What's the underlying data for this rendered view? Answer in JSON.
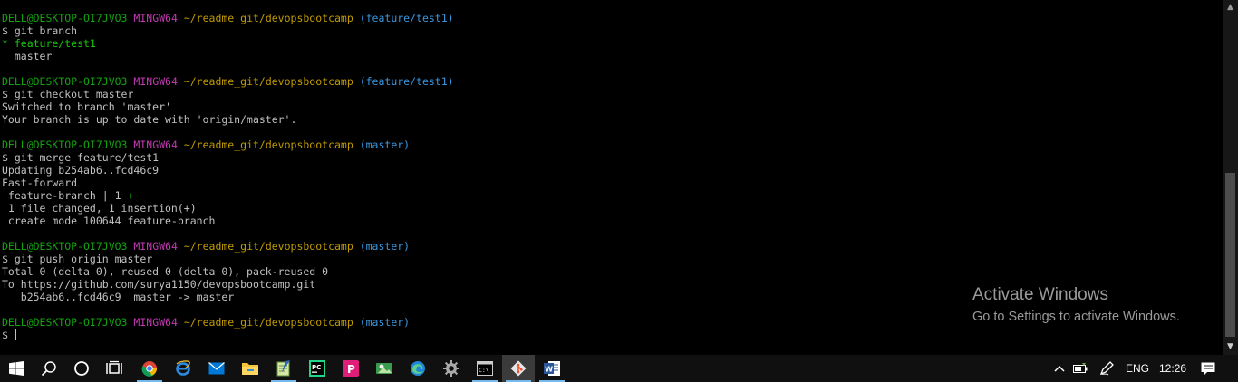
{
  "colors": {
    "green": "#13a10e",
    "magenta": "#c239b3",
    "yellow": "#c19c00",
    "cyan": "#3a96dd",
    "text": "#c0c0c0",
    "bright_green": "#16c60c"
  },
  "terminal": {
    "lines": [
      [
        [
          "DELL@DESKTOP-OI7JVO3",
          "green"
        ],
        [
          " ",
          "text"
        ],
        [
          "MINGW64",
          "magenta"
        ],
        [
          " ",
          "text"
        ],
        [
          "~/readme_git/devopsbootcamp",
          "yellow"
        ],
        [
          " ",
          "text"
        ],
        [
          "(feature/test1)",
          "cyan"
        ]
      ],
      [
        [
          "$ git branch",
          "text"
        ]
      ],
      [
        [
          "* feature/test1",
          "bright_green"
        ]
      ],
      [
        [
          "  master",
          "text"
        ]
      ],
      [],
      [
        [
          "DELL@DESKTOP-OI7JVO3",
          "green"
        ],
        [
          " ",
          "text"
        ],
        [
          "MINGW64",
          "magenta"
        ],
        [
          " ",
          "text"
        ],
        [
          "~/readme_git/devopsbootcamp",
          "yellow"
        ],
        [
          " ",
          "text"
        ],
        [
          "(feature/test1)",
          "cyan"
        ]
      ],
      [
        [
          "$ git checkout master",
          "text"
        ]
      ],
      [
        [
          "Switched to branch 'master'",
          "text"
        ]
      ],
      [
        [
          "Your branch is up to date with 'origin/master'.",
          "text"
        ]
      ],
      [],
      [
        [
          "DELL@DESKTOP-OI7JVO3",
          "green"
        ],
        [
          " ",
          "text"
        ],
        [
          "MINGW64",
          "magenta"
        ],
        [
          " ",
          "text"
        ],
        [
          "~/readme_git/devopsbootcamp",
          "yellow"
        ],
        [
          " ",
          "text"
        ],
        [
          "(master)",
          "cyan"
        ]
      ],
      [
        [
          "$ git merge feature/test1",
          "text"
        ]
      ],
      [
        [
          "Updating b254ab6..fcd46c9",
          "text"
        ]
      ],
      [
        [
          "Fast-forward",
          "text"
        ]
      ],
      [
        [
          " feature-branch | 1 ",
          "text"
        ],
        [
          "+",
          "bright_green"
        ]
      ],
      [
        [
          " 1 file changed, 1 insertion(+)",
          "text"
        ]
      ],
      [
        [
          " create mode 100644 feature-branch",
          "text"
        ]
      ],
      [],
      [
        [
          "DELL@DESKTOP-OI7JVO3",
          "green"
        ],
        [
          " ",
          "text"
        ],
        [
          "MINGW64",
          "magenta"
        ],
        [
          " ",
          "text"
        ],
        [
          "~/readme_git/devopsbootcamp",
          "yellow"
        ],
        [
          " ",
          "text"
        ],
        [
          "(master)",
          "cyan"
        ]
      ],
      [
        [
          "$ git push origin master",
          "text"
        ]
      ],
      [
        [
          "Total 0 (delta 0), reused 0 (delta 0), pack-reused 0",
          "text"
        ]
      ],
      [
        [
          "To https://github.com/surya1150/devopsbootcamp.git",
          "text"
        ]
      ],
      [
        [
          "   b254ab6..fcd46c9  master -> master",
          "text"
        ]
      ],
      [],
      [
        [
          "DELL@DESKTOP-OI7JVO3",
          "green"
        ],
        [
          " ",
          "text"
        ],
        [
          "MINGW64",
          "magenta"
        ],
        [
          " ",
          "text"
        ],
        [
          "~/readme_git/devopsbootcamp",
          "yellow"
        ],
        [
          " ",
          "text"
        ],
        [
          "(master)",
          "cyan"
        ]
      ],
      [
        [
          "$ ",
          "text"
        ]
      ]
    ]
  },
  "watermark": {
    "title": "Activate Windows",
    "subtitle": "Go to Settings to activate Windows."
  },
  "taskbar": {
    "apps": [
      {
        "name": "windows-start-icon",
        "state": "normal"
      },
      {
        "name": "search-icon",
        "state": "normal"
      },
      {
        "name": "cortana-icon",
        "state": "normal"
      },
      {
        "name": "task-view-icon",
        "state": "normal"
      },
      {
        "name": "chrome-icon",
        "state": "running"
      },
      {
        "name": "internet-explorer-icon",
        "state": "normal"
      },
      {
        "name": "mail-icon",
        "state": "normal"
      },
      {
        "name": "file-explorer-icon",
        "state": "normal"
      },
      {
        "name": "notepad-icon",
        "state": "running"
      },
      {
        "name": "pycharm-icon",
        "state": "normal"
      },
      {
        "name": "p-app-icon",
        "state": "normal"
      },
      {
        "name": "photos-icon",
        "state": "normal"
      },
      {
        "name": "edge-icon",
        "state": "normal"
      },
      {
        "name": "settings-icon",
        "state": "normal"
      },
      {
        "name": "cmd-icon",
        "state": "running"
      },
      {
        "name": "git-bash-icon",
        "state": "active"
      },
      {
        "name": "word-icon",
        "state": "running"
      }
    ],
    "tray": {
      "language": "ENG",
      "clock": "12:26"
    }
  }
}
